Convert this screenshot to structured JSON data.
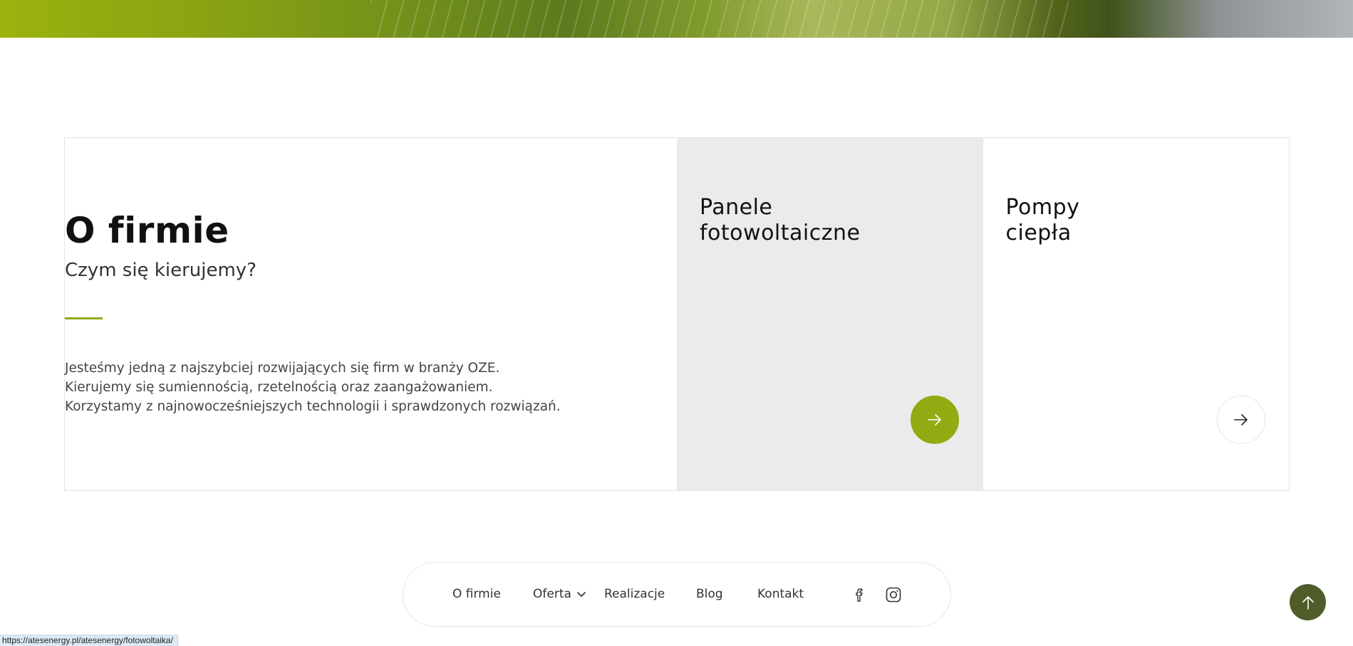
{
  "colors": {
    "accent": "#94aa13",
    "card_active_bg": "#ebebeb",
    "scroll_top_bg": "#4f5d2b"
  },
  "about": {
    "title": "O firmie",
    "subtitle": "Czym się kierujemy?",
    "paragraphs": [
      "Jesteśmy jedną z najszybciej rozwijających się firm w branży OZE.",
      "Kierujemy się sumiennością, rzetelnością oraz zaangażowaniem.",
      "Korzystamy z najnowocześniejszych technologii i sprawdzonych rozwiązań."
    ]
  },
  "offers": [
    {
      "title_lines": [
        "Panele",
        "fotowoltaiczne"
      ],
      "icon": "arrow-right-icon",
      "active": true
    },
    {
      "title_lines": [
        "Pompy",
        "ciepła"
      ],
      "icon": "arrow-right-icon",
      "active": false
    }
  ],
  "footer_nav": {
    "items": [
      {
        "label": "O firmie"
      },
      {
        "label": "Oferta",
        "icon": "chevron-down-icon"
      },
      {
        "label": "Realizacje"
      },
      {
        "label": "Blog"
      },
      {
        "label": "Kontakt"
      }
    ],
    "social": [
      "facebook-icon",
      "instagram-icon"
    ]
  },
  "scroll_top": {
    "icon": "arrow-up-icon"
  },
  "status_bar": {
    "url": "https://atesenergy.pl/atesenergy/fotowoltaika/"
  }
}
